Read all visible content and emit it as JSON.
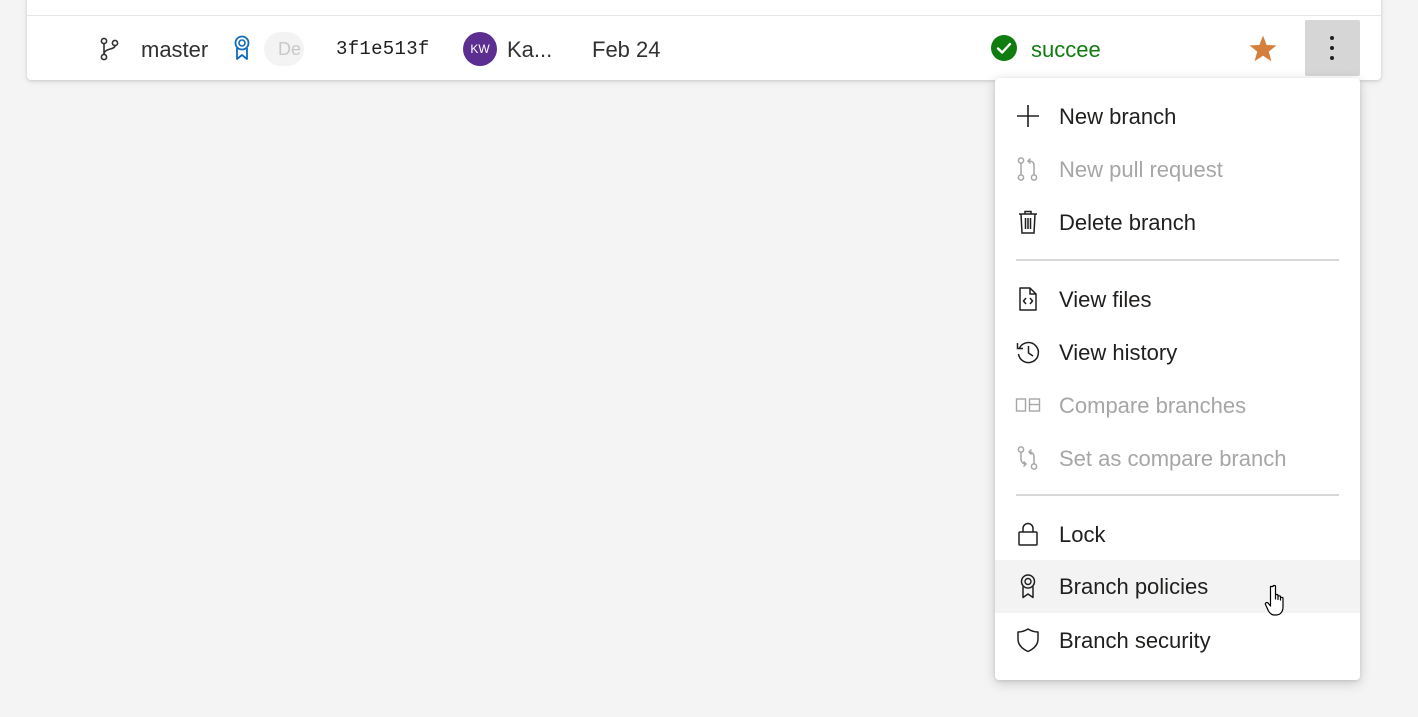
{
  "branch_row": {
    "name": "master",
    "default_badge": "De",
    "commit": "3f1e513f",
    "author_initials": "KW",
    "author_name": "Ka...",
    "date": "Feb 24",
    "status": "succee",
    "favorited": true
  },
  "colors": {
    "avatar": "#5c2e91",
    "status_success": "#107c10",
    "star": "#d67f3c",
    "policy_icon": "#0f6cbd"
  },
  "menu": {
    "items": [
      {
        "label": "New branch",
        "icon": "plus-icon",
        "enabled": true
      },
      {
        "label": "New pull request",
        "icon": "pull-request-icon",
        "enabled": false
      },
      {
        "label": "Delete branch",
        "icon": "trash-icon",
        "enabled": true
      },
      {
        "label": "View files",
        "icon": "code-file-icon",
        "enabled": true
      },
      {
        "label": "View history",
        "icon": "history-icon",
        "enabled": true
      },
      {
        "label": "Compare branches",
        "icon": "compare-icon",
        "enabled": false
      },
      {
        "label": "Set as compare branch",
        "icon": "compare-branch-icon",
        "enabled": false
      },
      {
        "label": "Lock",
        "icon": "lock-icon",
        "enabled": true
      },
      {
        "label": "Branch policies",
        "icon": "policy-ribbon-icon",
        "enabled": true,
        "hovered": true
      },
      {
        "label": "Branch security",
        "icon": "shield-icon",
        "enabled": true
      }
    ]
  }
}
